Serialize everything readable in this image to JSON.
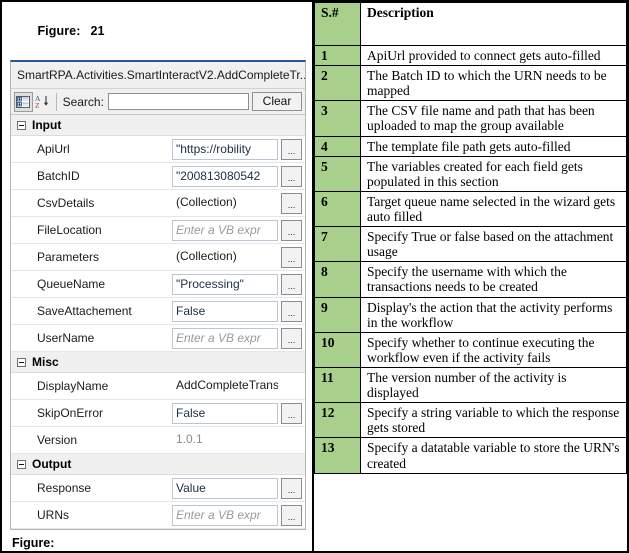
{
  "figure_top": {
    "label": "Figure:",
    "number": "21"
  },
  "figure_bottom": {
    "label": "Figure:"
  },
  "property_panel": {
    "activity_title": "SmartRPA.Activities.SmartInteractV2.AddCompleteTr...",
    "toolbar": {
      "categorized_icon": "categorized-view-icon",
      "alphabetical_icon": "alphabetical-sort-icon",
      "search_label": "Search:",
      "search_value": "",
      "search_placeholder": "",
      "clear_label": "Clear"
    },
    "categories": [
      {
        "name": "Input",
        "rows": [
          {
            "name": "ApiUrl",
            "value": "\"https://robility",
            "style": "value",
            "button": true
          },
          {
            "name": "BatchID",
            "value": "\"200813080542",
            "style": "value",
            "button": true
          },
          {
            "name": "CsvDetails",
            "value": "(Collection)",
            "style": "plain",
            "button": true
          },
          {
            "name": "FileLocation",
            "value": "Enter a VB expr",
            "style": "placeholder",
            "button": true
          },
          {
            "name": "Parameters",
            "value": "(Collection)",
            "style": "plain",
            "button": true
          },
          {
            "name": "QueueName",
            "value": "\"Processing\"",
            "style": "value",
            "button": true
          },
          {
            "name": "SaveAttachement",
            "value": "False",
            "style": "value",
            "button": true
          },
          {
            "name": "UserName",
            "value": "Enter a VB expr",
            "style": "placeholder",
            "button": true
          }
        ]
      },
      {
        "name": "Misc",
        "rows": [
          {
            "name": "DisplayName",
            "value": "AddCompleteTransa",
            "style": "plain",
            "button": false
          },
          {
            "name": "SkipOnError",
            "value": "False",
            "style": "value",
            "button": true
          },
          {
            "name": "Version",
            "value": "1.0.1",
            "style": "dim",
            "button": false
          }
        ]
      },
      {
        "name": "Output",
        "rows": [
          {
            "name": "Response",
            "value": "Value",
            "style": "value",
            "button": true
          },
          {
            "name": "URNs",
            "value": "Enter a VB expr",
            "style": "placeholder",
            "button": true
          }
        ]
      }
    ]
  },
  "description_table": {
    "headers": {
      "sn": "S.#",
      "description": "Description"
    },
    "rows": [
      {
        "sn": "1",
        "description": "ApiUrl provided to connect gets auto-filled"
      },
      {
        "sn": "2",
        "description": "The Batch ID to which the URN needs to be mapped"
      },
      {
        "sn": "3",
        "description": "The CSV file name and path that has been uploaded to map the group available"
      },
      {
        "sn": "4",
        "description": "The template file path gets auto-filled"
      },
      {
        "sn": "5",
        "description": "The variables created for each field gets populated in this section"
      },
      {
        "sn": "6",
        "description": "Target queue name selected in the wizard gets auto filled"
      },
      {
        "sn": "7",
        "description": "Specify True or false based on the attachment usage"
      },
      {
        "sn": "8",
        "description": "Specify the username with which the transactions needs to be created"
      },
      {
        "sn": "9",
        "description": "Display's the action that the activity performs in the workflow"
      },
      {
        "sn": "10",
        "description": "Specify whether to continue executing the workflow even if the activity fails"
      },
      {
        "sn": "11",
        "description": "The version number of the activity is displayed"
      },
      {
        "sn": "12",
        "description": "Specify a string variable to which the response gets stored"
      },
      {
        "sn": "13",
        "description": "Specify a datatable variable to store the URN's created"
      }
    ]
  },
  "colors": {
    "header_green": "#a9cf8d",
    "panel_accent_blue": "#2a5699",
    "value_text": "#1b2e4a",
    "placeholder_text": "#9a9a9a"
  }
}
